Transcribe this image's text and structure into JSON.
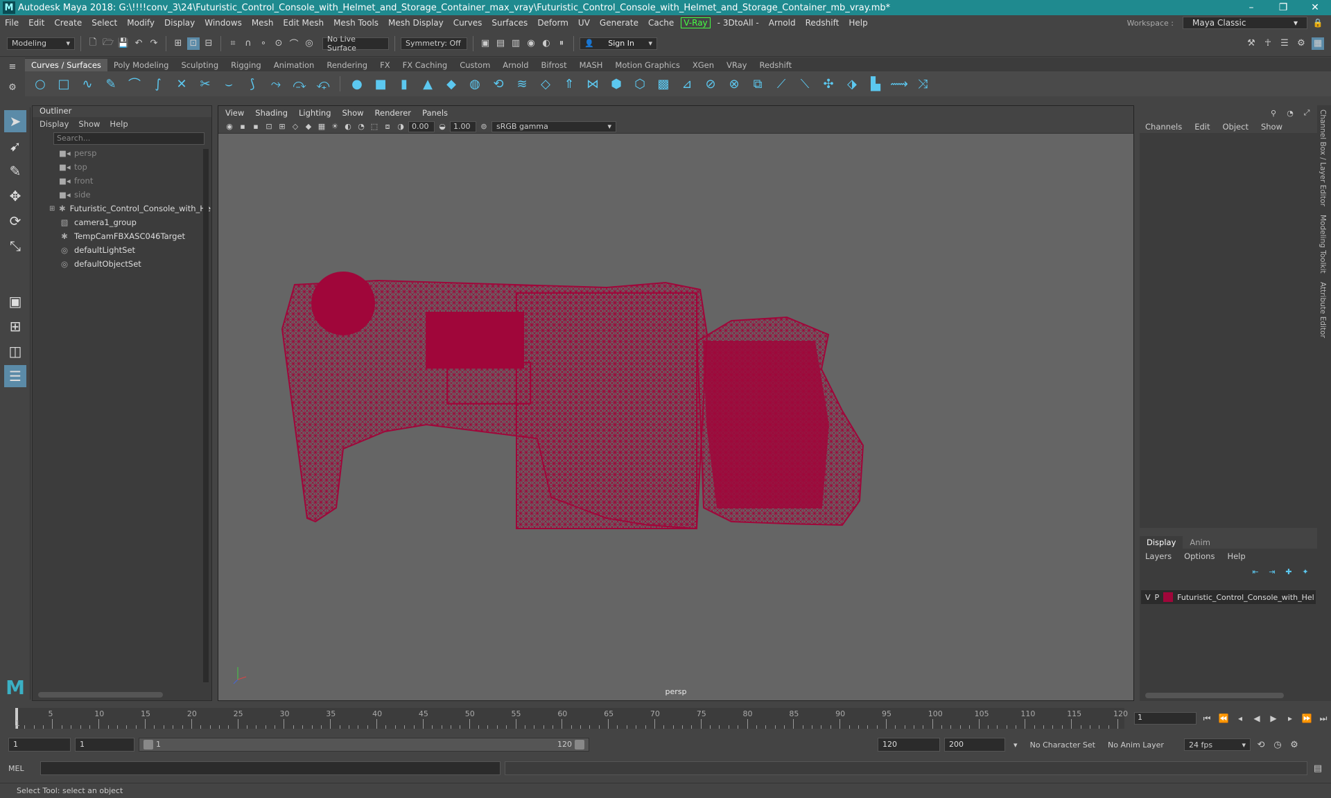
{
  "window": {
    "title": "Autodesk Maya 2018: G:\\!!!!conv_3\\24\\Futuristic_Control_Console_with_Helmet_and_Storage_Container_max_vray\\Futuristic_Control_Console_with_Helmet_and_Storage_Container_mb_vray.mb*",
    "minimize": "–",
    "maximize": "❐",
    "close": "✕"
  },
  "menubar": {
    "items": [
      "File",
      "Edit",
      "Create",
      "Select",
      "Modify",
      "Display",
      "Windows",
      "Mesh",
      "Edit Mesh",
      "Mesh Tools",
      "Mesh Display",
      "Curves",
      "Surfaces",
      "Deform",
      "UV",
      "Generate",
      "Cache"
    ],
    "vray": "V-Ray",
    "items2": [
      "- 3DtoAll -",
      "Arnold",
      "Redshift",
      "Help"
    ],
    "workspace_label": "Workspace :",
    "workspace_value": "Maya Classic"
  },
  "status": {
    "mode": "Modeling",
    "live_surface": "No Live Surface",
    "symmetry": "Symmetry: Off",
    "sign_in": "Sign In"
  },
  "shelf": {
    "tabs": [
      "Curves / Surfaces",
      "Poly Modeling",
      "Sculpting",
      "Rigging",
      "Animation",
      "Rendering",
      "FX",
      "FX Caching",
      "Custom",
      "Arnold",
      "Bifrost",
      "MASH",
      "Motion Graphics",
      "XGen",
      "VRay",
      "Redshift"
    ],
    "active": "Curves / Surfaces"
  },
  "outliner": {
    "title": "Outliner",
    "menu": [
      "Display",
      "Show",
      "Help"
    ],
    "search_placeholder": "Search...",
    "items": [
      {
        "label": "persp",
        "icon": "camera-icon",
        "dim": true
      },
      {
        "label": "top",
        "icon": "camera-icon",
        "dim": true
      },
      {
        "label": "front",
        "icon": "camera-icon",
        "dim": true
      },
      {
        "label": "side",
        "icon": "camera-icon",
        "dim": true
      },
      {
        "label": "Futuristic_Control_Console_with_Hel",
        "icon": "transform-icon",
        "expand": true
      },
      {
        "label": "camera1_group",
        "icon": "group-icon"
      },
      {
        "label": "TempCamFBXASC046Target",
        "icon": "transform-icon"
      },
      {
        "label": "defaultLightSet",
        "icon": "set-icon"
      },
      {
        "label": "defaultObjectSet",
        "icon": "set-icon"
      }
    ]
  },
  "viewport": {
    "menu": [
      "View",
      "Shading",
      "Lighting",
      "Show",
      "Renderer",
      "Panels"
    ],
    "exposure": "0.00",
    "gamma": "1.00",
    "colorspace": "sRGB gamma",
    "camera": "persp",
    "wire_color": "#a0063a"
  },
  "channelbox": {
    "menu": [
      "Channels",
      "Edit",
      "Object",
      "Show"
    ],
    "vtabs": [
      "Channel Box / Layer Editor",
      "Modeling Toolkit",
      "Attribute Editor"
    ]
  },
  "layers": {
    "tabs": [
      "Display",
      "Anim"
    ],
    "menu": [
      "Layers",
      "Options",
      "Help"
    ],
    "layer": {
      "v": "V",
      "p": "P",
      "name": "Futuristic_Control_Console_with_Hel",
      "color": "#a0063a"
    }
  },
  "timeline": {
    "ticks": [
      "5",
      "10",
      "15",
      "20",
      "25",
      "30",
      "35",
      "40",
      "45",
      "50",
      "55",
      "60",
      "65",
      "70",
      "75",
      "80",
      "85",
      "90",
      "95",
      "100",
      "105",
      "110",
      "115",
      "120"
    ],
    "start_label": "1",
    "current_frame": "1"
  },
  "range": {
    "start": "1",
    "playback_start": "1",
    "slider_start": "1",
    "slider_end": "120",
    "playback_end": "120",
    "end": "200",
    "character_set": "No Character Set",
    "anim_layer": "No Anim Layer",
    "fps": "24 fps"
  },
  "cmdline": {
    "label": "MEL"
  },
  "helpline": {
    "text": "Select Tool: select an object"
  }
}
